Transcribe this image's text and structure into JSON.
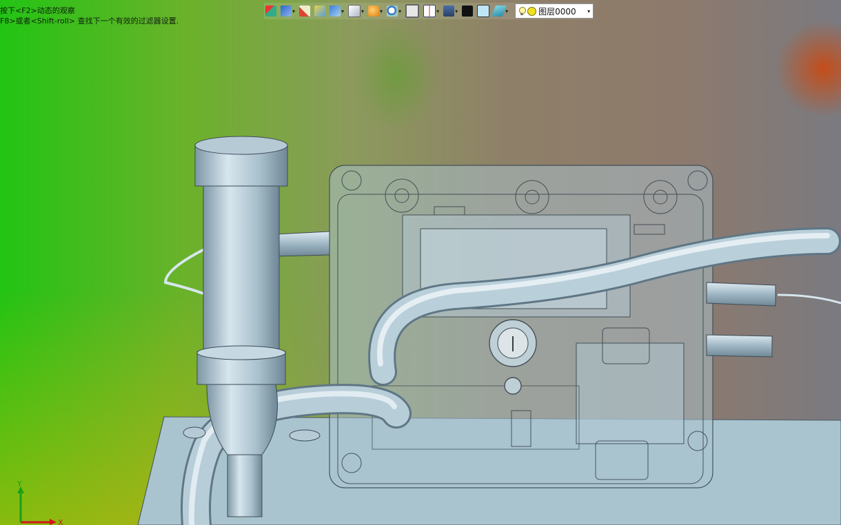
{
  "hints": [
    "按下<F2>动态的观察",
    "F8>或者<Shift-roll> 查找下一个有效的过滤器设置."
  ],
  "toolbar": {
    "buttons": [
      {
        "name": "exit-icon",
        "dropdown": false
      },
      {
        "name": "save-icon",
        "dropdown": true
      },
      {
        "name": "brush-icon",
        "dropdown": false
      },
      {
        "name": "shaded-cube-icon",
        "dropdown": false
      },
      {
        "name": "blue-cube-icon",
        "dropdown": true
      },
      {
        "name": "white-cube-icon",
        "dropdown": true
      },
      {
        "name": "sphere-icon",
        "dropdown": true
      },
      {
        "name": "zoom-icon",
        "dropdown": true
      },
      {
        "name": "frame-icon",
        "dropdown": false
      },
      {
        "name": "split-view-icon",
        "dropdown": true
      },
      {
        "name": "monitor-icon",
        "dropdown": true
      },
      {
        "name": "line-style-icon",
        "dropdown": false
      },
      {
        "name": "color-square-icon",
        "dropdown": false
      },
      {
        "name": "layers-icon",
        "dropdown": true
      }
    ],
    "dropdown_glyph": "▾",
    "layer": {
      "value": "图层0000",
      "caret": "▾"
    }
  },
  "triad": {
    "y_label": "Y",
    "x_label": "X"
  },
  "colors": {
    "part_fill": "#b7cdd8",
    "part_edge": "#4a5a66",
    "transparent_box": "#aac2cf"
  }
}
